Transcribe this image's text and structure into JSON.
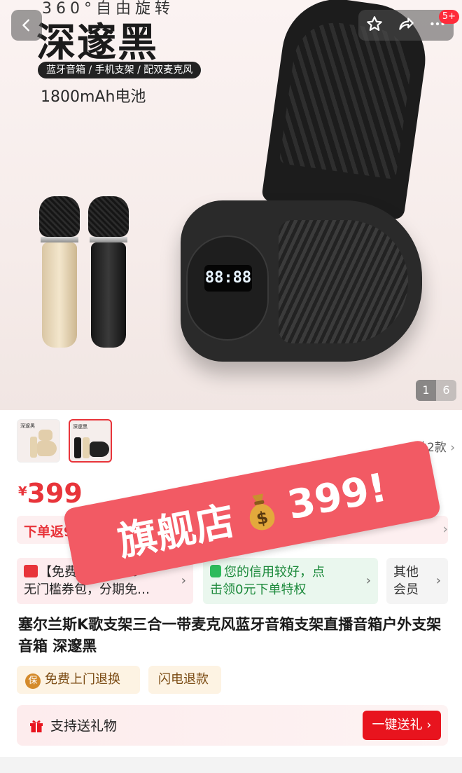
{
  "nav": {
    "back_icon": "chevron-left-icon",
    "actions": [
      "star-icon",
      "share-icon",
      "more-icon"
    ],
    "notification_badge": "5+"
  },
  "hero": {
    "top_caption": "360°自由旋转",
    "title": "深邃黑",
    "tagline": "蓝牙音箱 / 手机支架 / 配双麦克风",
    "battery": "1800mAh电池",
    "display": "88:88",
    "counter_current": "1",
    "counter_total": "6"
  },
  "variants": {
    "thumb_labels": [
      "深邃黑",
      "深邃黑"
    ],
    "selected_index": 1,
    "count_text": "共2款"
  },
  "price": {
    "currency": "¥",
    "amount": "399",
    "promo": "下单返9折"
  },
  "sticker": {
    "text_left": "旗舰店",
    "icon": "money-bag-icon",
    "text_right": "399!"
  },
  "coupons": {
    "red_line1": "【免费领取】¥80",
    "red_line2": "无门槛券包，分期免…",
    "green_line1": "您的信用较好，点",
    "green_line2": "击领0元下单特权",
    "gray_line1": "其他",
    "gray_line2": "会员"
  },
  "product": {
    "title": "塞尔兰斯K歌支架三合一带麦克风蓝牙音箱支架直播音箱户外支架音箱 深邃黑"
  },
  "services": {
    "free_return": "免费上门退换",
    "refund": "闪电退款",
    "shield_char": "保"
  },
  "gift": {
    "label": "支持送礼物",
    "button": "一键送礼"
  },
  "colors": {
    "accent_red": "#e8343a",
    "sticker_pink": "#f25a64",
    "green": "#1d8a3c"
  }
}
